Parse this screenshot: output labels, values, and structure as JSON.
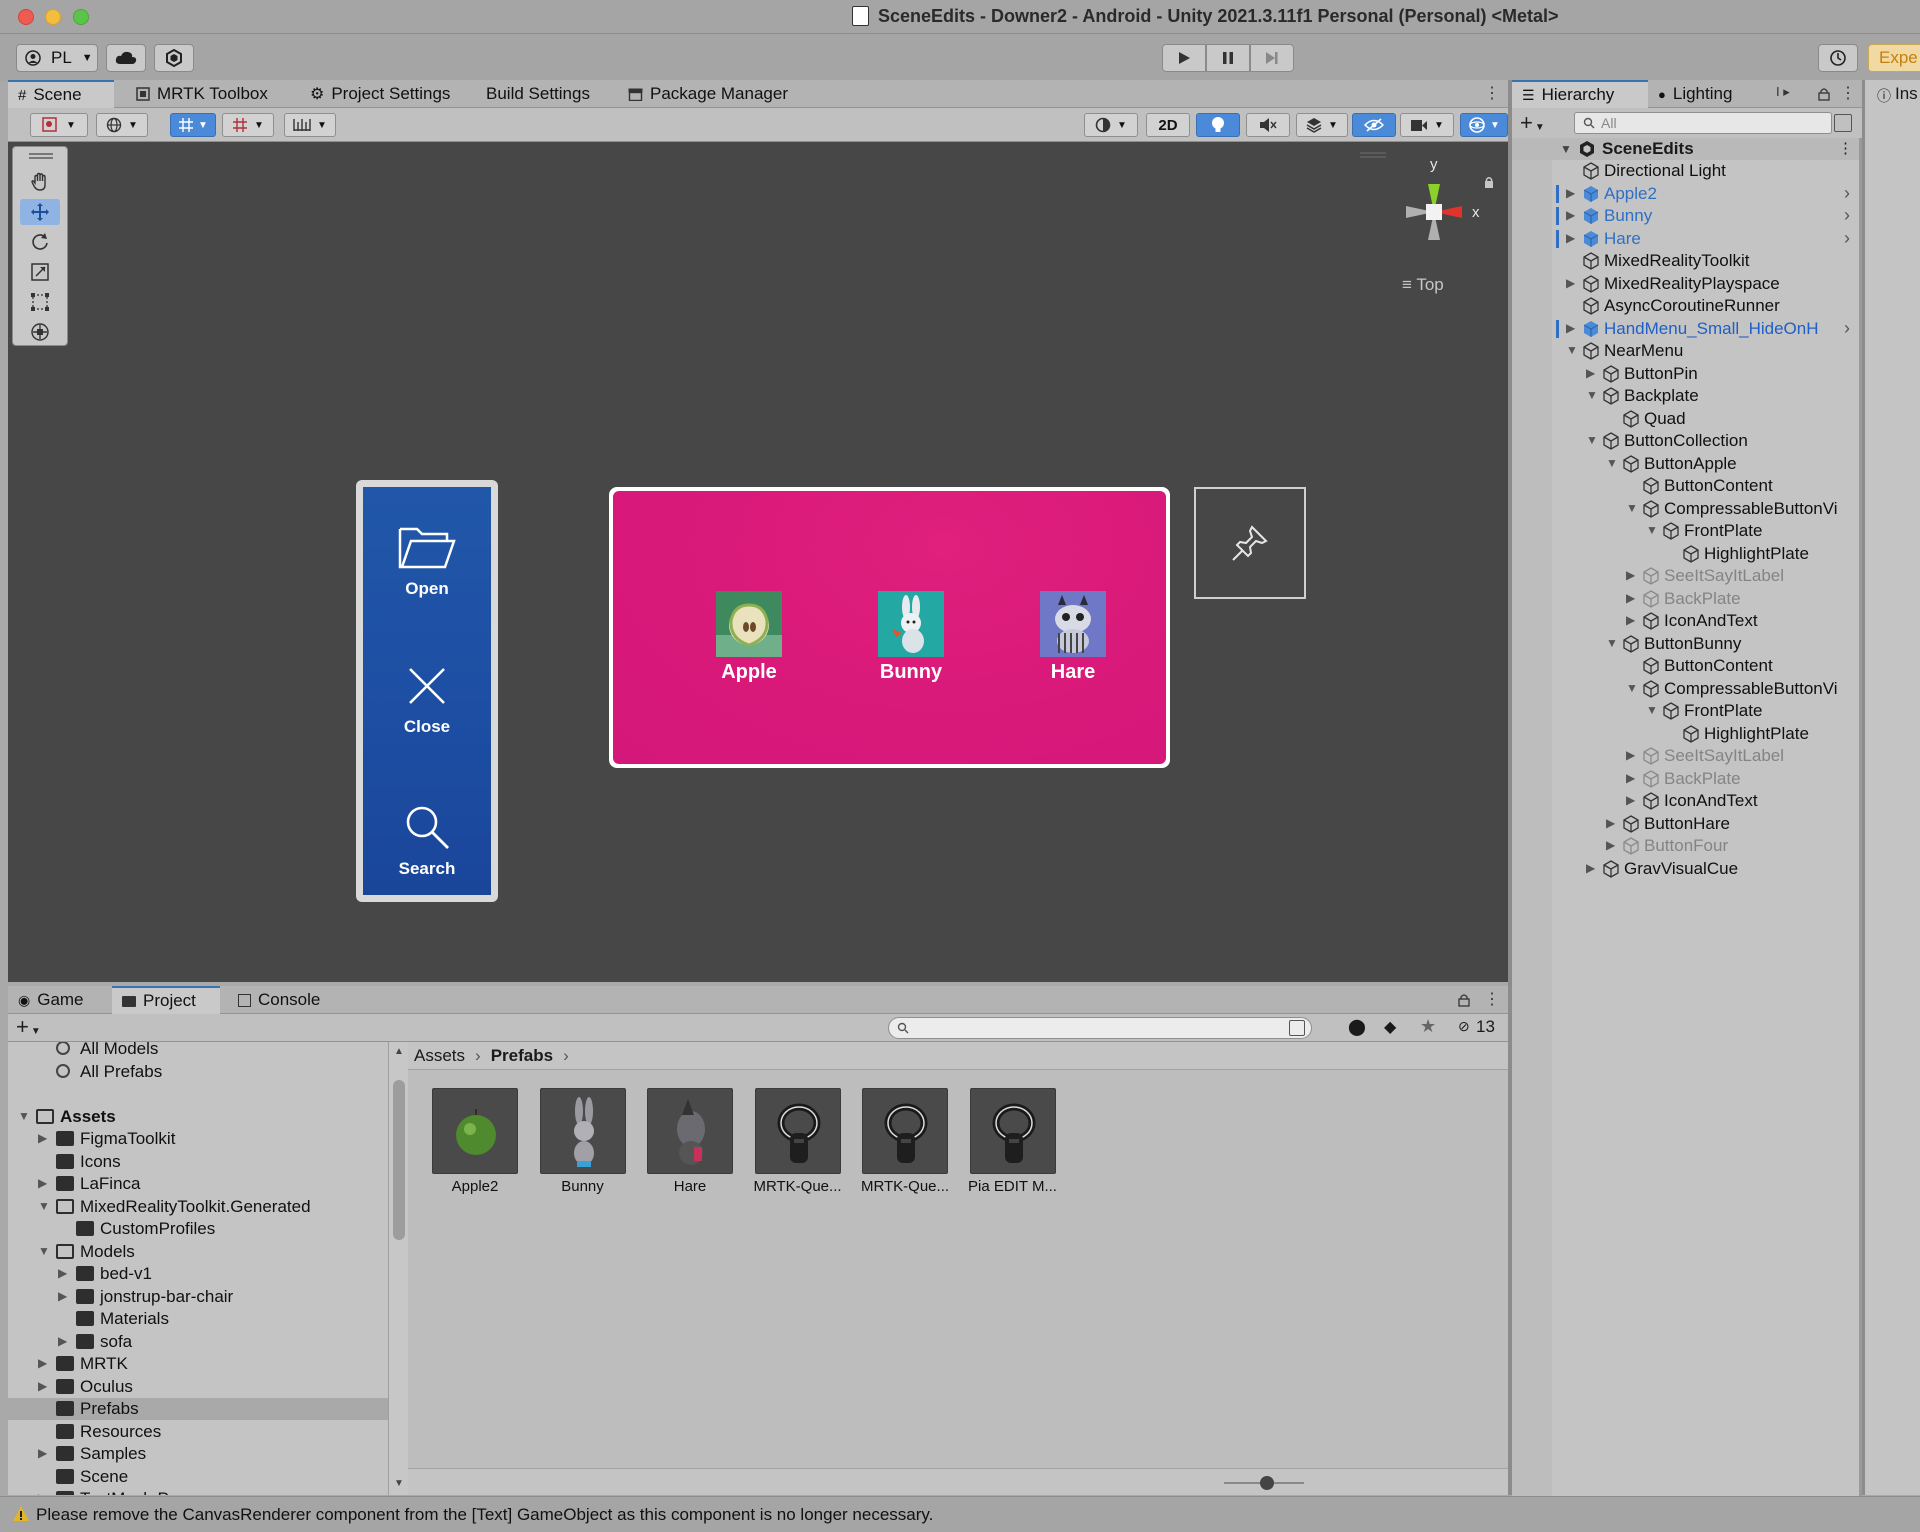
{
  "window": {
    "title": "SceneEdits - Downer2 - Android - Unity 2021.3.11f1 Personal (Personal) <Metal>"
  },
  "toolbar": {
    "account_label": "PL",
    "experimental_label": "Expe"
  },
  "scene_tabs": [
    {
      "label": "Scene",
      "icon": "grid-icon"
    },
    {
      "label": "MRTK Toolbox",
      "icon": "toolbox-icon"
    },
    {
      "label": "Project Settings",
      "icon": "gear-icon"
    },
    {
      "label": "Build Settings",
      "icon": ""
    },
    {
      "label": "Package Manager",
      "icon": "package-icon"
    }
  ],
  "scene_toolbar": {
    "mode_2d_label": "2D"
  },
  "viewport": {
    "gizmo_y": "y",
    "gizmo_x": "x",
    "view_label": "Top",
    "hand_menu": [
      {
        "label": "Open",
        "icon": "folder-open-icon"
      },
      {
        "label": "Close",
        "icon": "close-icon"
      },
      {
        "label": "Search",
        "icon": "search-icon"
      }
    ],
    "near_menu": [
      {
        "label": "Apple",
        "icon": "apple-icon"
      },
      {
        "label": "Bunny",
        "icon": "bunny-icon"
      },
      {
        "label": "Hare",
        "icon": "hare-icon"
      }
    ]
  },
  "hierarchy": {
    "tabs": [
      {
        "label": "Hierarchy"
      },
      {
        "label": "Lighting"
      }
    ],
    "search_placeholder": "All",
    "inspector_tab_label": "Ins",
    "root": "SceneEdits",
    "items": [
      {
        "label": "Directional Light",
        "depth": 0,
        "expander": "none",
        "style": "normal"
      },
      {
        "label": "Apple2",
        "depth": 0,
        "expander": "collapsed",
        "style": "prefab"
      },
      {
        "label": "Bunny",
        "depth": 0,
        "expander": "collapsed",
        "style": "prefab"
      },
      {
        "label": "Hare",
        "depth": 0,
        "expander": "collapsed",
        "style": "prefab"
      },
      {
        "label": "MixedRealityToolkit",
        "depth": 0,
        "expander": "none",
        "style": "normal"
      },
      {
        "label": "MixedRealityPlayspace",
        "depth": 0,
        "expander": "collapsed",
        "style": "normal"
      },
      {
        "label": "AsyncCoroutineRunner",
        "depth": 0,
        "expander": "none",
        "style": "normal"
      },
      {
        "label": "HandMenu_Small_HideOnH",
        "depth": 0,
        "expander": "collapsed",
        "style": "prefab-dark"
      },
      {
        "label": "NearMenu",
        "depth": 0,
        "expander": "expanded",
        "style": "normal"
      },
      {
        "label": "ButtonPin",
        "depth": 1,
        "expander": "collapsed",
        "style": "normal"
      },
      {
        "label": "Backplate",
        "depth": 1,
        "expander": "expanded",
        "style": "normal"
      },
      {
        "label": "Quad",
        "depth": 2,
        "expander": "none",
        "style": "normal"
      },
      {
        "label": "ButtonCollection",
        "depth": 1,
        "expander": "expanded",
        "style": "normal"
      },
      {
        "label": "ButtonApple",
        "depth": 2,
        "expander": "expanded",
        "style": "normal"
      },
      {
        "label": "ButtonContent",
        "depth": 3,
        "expander": "none",
        "style": "normal"
      },
      {
        "label": "CompressableButtonVi",
        "depth": 3,
        "expander": "expanded",
        "style": "normal"
      },
      {
        "label": "FrontPlate",
        "depth": 4,
        "expander": "expanded",
        "style": "normal"
      },
      {
        "label": "HighlightPlate",
        "depth": 5,
        "expander": "none",
        "style": "normal"
      },
      {
        "label": "SeeItSayItLabel",
        "depth": 3,
        "expander": "collapsed",
        "style": "disabled"
      },
      {
        "label": "BackPlate",
        "depth": 3,
        "expander": "collapsed",
        "style": "disabled"
      },
      {
        "label": "IconAndText",
        "depth": 3,
        "expander": "collapsed",
        "style": "normal"
      },
      {
        "label": "ButtonBunny",
        "depth": 2,
        "expander": "expanded",
        "style": "normal"
      },
      {
        "label": "ButtonContent",
        "depth": 3,
        "expander": "none",
        "style": "normal"
      },
      {
        "label": "CompressableButtonVi",
        "depth": 3,
        "expander": "expanded",
        "style": "normal"
      },
      {
        "label": "FrontPlate",
        "depth": 4,
        "expander": "expanded",
        "style": "normal"
      },
      {
        "label": "HighlightPlate",
        "depth": 5,
        "expander": "none",
        "style": "normal"
      },
      {
        "label": "SeeItSayItLabel",
        "depth": 3,
        "expander": "collapsed",
        "style": "disabled"
      },
      {
        "label": "BackPlate",
        "depth": 3,
        "expander": "collapsed",
        "style": "disabled"
      },
      {
        "label": "IconAndText",
        "depth": 3,
        "expander": "collapsed",
        "style": "normal"
      },
      {
        "label": "ButtonHare",
        "depth": 2,
        "expander": "collapsed",
        "style": "normal"
      },
      {
        "label": "ButtonFour",
        "depth": 2,
        "expander": "collapsed",
        "style": "disabled"
      },
      {
        "label": "GravVisualCue",
        "depth": 1,
        "expander": "collapsed",
        "style": "normal"
      }
    ]
  },
  "bottom_tabs": [
    {
      "label": "Game",
      "icon": "gamepad-icon"
    },
    {
      "label": "Project",
      "icon": "folder-icon"
    },
    {
      "label": "Console",
      "icon": "console-icon"
    }
  ],
  "project": {
    "hidden_count": "13",
    "tree": [
      {
        "label": "All Models",
        "depth": 1,
        "kind": "search",
        "expander": "none"
      },
      {
        "label": "All Prefabs",
        "depth": 1,
        "kind": "search",
        "expander": "none"
      },
      {
        "label": "",
        "depth": 0,
        "kind": "spacer",
        "expander": "none"
      },
      {
        "label": "Assets",
        "depth": 0,
        "kind": "folder",
        "expander": "expanded",
        "bold": true
      },
      {
        "label": "FigmaToolkit",
        "depth": 1,
        "kind": "folder",
        "expander": "collapsed"
      },
      {
        "label": "Icons",
        "depth": 1,
        "kind": "folder",
        "expander": "none"
      },
      {
        "label": "LaFinca",
        "depth": 1,
        "kind": "folder",
        "expander": "collapsed"
      },
      {
        "label": "MixedRealityToolkit.Generated",
        "depth": 1,
        "kind": "folder",
        "expander": "expanded"
      },
      {
        "label": "CustomProfiles",
        "depth": 2,
        "kind": "folder",
        "expander": "none"
      },
      {
        "label": "Models",
        "depth": 1,
        "kind": "folder",
        "expander": "expanded"
      },
      {
        "label": "bed-v1",
        "depth": 2,
        "kind": "folder",
        "expander": "collapsed"
      },
      {
        "label": "jonstrup-bar-chair",
        "depth": 2,
        "kind": "folder",
        "expander": "collapsed"
      },
      {
        "label": "Materials",
        "depth": 2,
        "kind": "folder",
        "expander": "none"
      },
      {
        "label": "sofa",
        "depth": 2,
        "kind": "folder",
        "expander": "collapsed"
      },
      {
        "label": "MRTK",
        "depth": 1,
        "kind": "folder",
        "expander": "collapsed"
      },
      {
        "label": "Oculus",
        "depth": 1,
        "kind": "folder",
        "expander": "collapsed"
      },
      {
        "label": "Prefabs",
        "depth": 1,
        "kind": "folder",
        "expander": "none",
        "selected": true
      },
      {
        "label": "Resources",
        "depth": 1,
        "kind": "folder",
        "expander": "none"
      },
      {
        "label": "Samples",
        "depth": 1,
        "kind": "folder",
        "expander": "collapsed"
      },
      {
        "label": "Scene",
        "depth": 1,
        "kind": "folder",
        "expander": "none"
      },
      {
        "label": "TextMesh Pro",
        "depth": 1,
        "kind": "folder",
        "expander": "collapsed"
      }
    ],
    "breadcrumb": [
      "Assets",
      "Prefabs"
    ],
    "assets": [
      {
        "name": "Apple2",
        "icon": "apple-model-icon"
      },
      {
        "name": "Bunny",
        "icon": "bunny-model-icon"
      },
      {
        "name": "Hare",
        "icon": "hare-model-icon"
      },
      {
        "name": "MRTK-Que...",
        "icon": "controller-icon"
      },
      {
        "name": "MRTK-Que...",
        "icon": "controller-icon"
      },
      {
        "name": "Pia EDIT M...",
        "icon": "controller-icon"
      }
    ]
  },
  "status": {
    "message": "Please remove the CanvasRenderer component from the [Text] GameObject as this component is no longer necessary."
  },
  "colors": {
    "hand_menu_blue": "#1f50a3",
    "near_menu_magenta": "#db1a7a",
    "viewport_bg": "#474747",
    "selection_blue": "#4b8ad8"
  }
}
